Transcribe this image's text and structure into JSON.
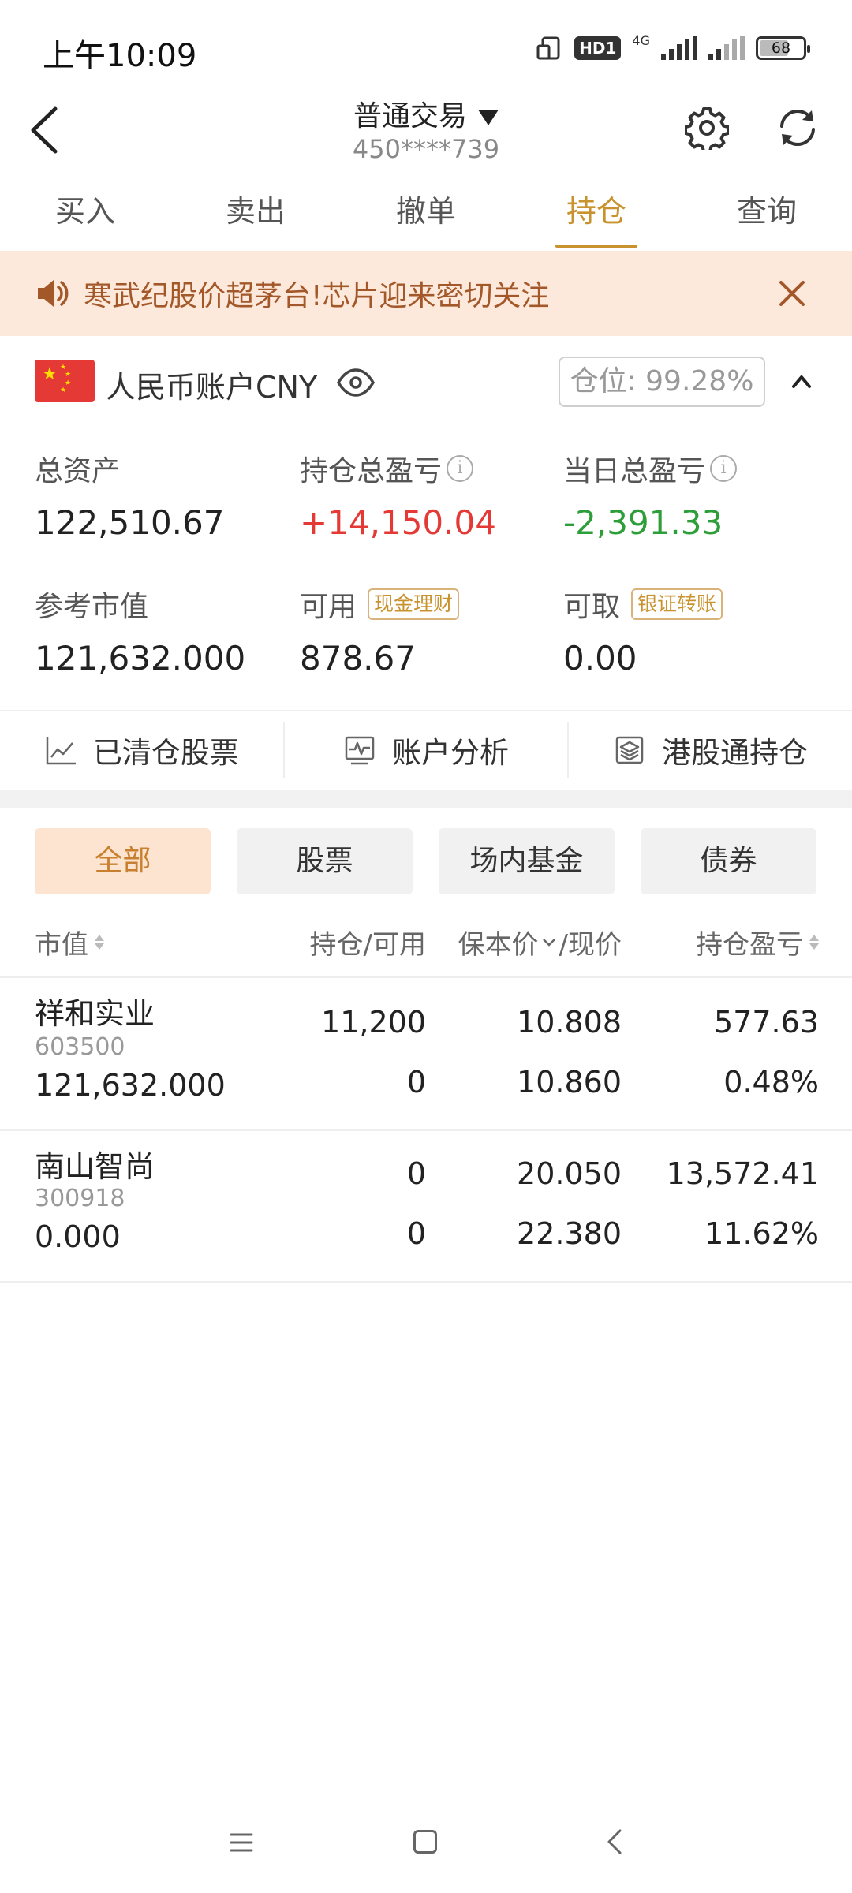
{
  "status": {
    "time": "上午10:09",
    "hd": "HD1",
    "net": "4G",
    "battery": "68"
  },
  "header": {
    "title": "普通交易",
    "account_masked": "450****739"
  },
  "tabs": [
    {
      "label": "买入",
      "active": false
    },
    {
      "label": "卖出",
      "active": false
    },
    {
      "label": "撤单",
      "active": false
    },
    {
      "label": "持仓",
      "active": true
    },
    {
      "label": "查询",
      "active": false
    }
  ],
  "notice": {
    "text": "寒武纪股价超茅台!芯片迎来密切关注"
  },
  "account": {
    "name": "人民币账户CNY",
    "position_ratio": "仓位: 99.28%",
    "total_assets_label": "总资产",
    "total_assets": "122,510.67",
    "holding_pl_label": "持仓总盈亏",
    "holding_pl": "+14,150.04",
    "daily_pl_label": "当日总盈亏",
    "daily_pl": "-2,391.33",
    "market_value_label": "参考市值",
    "market_value": "121,632.000",
    "available_label": "可用",
    "available_tag": "现金理财",
    "available": "878.67",
    "withdrawable_label": "可取",
    "withdrawable_tag": "银证转账",
    "withdrawable": "0.00"
  },
  "actions": [
    {
      "label": "已清仓股票",
      "icon": "chart-line-icon"
    },
    {
      "label": "账户分析",
      "icon": "analysis-icon"
    },
    {
      "label": "港股通持仓",
      "icon": "layers-icon"
    }
  ],
  "filters": [
    {
      "label": "全部",
      "active": true
    },
    {
      "label": "股票",
      "active": false
    },
    {
      "label": "场内基金",
      "active": false
    },
    {
      "label": "债券",
      "active": false
    }
  ],
  "table": {
    "headers": {
      "market_value": "市值",
      "position": "持仓/可用",
      "cost_price_a": "保本价",
      "cost_price_b": "/现价",
      "pl": "持仓盈亏"
    },
    "rows": [
      {
        "name": "祥和实业",
        "code": "603500",
        "market_value": "121,632.000",
        "position": "11,200",
        "available": "0",
        "cost": "10.808",
        "price": "10.860",
        "pl": "577.63",
        "pl_pct": "0.48%"
      },
      {
        "name": "南山智尚",
        "code": "300918",
        "market_value": "0.000",
        "position": "0",
        "available": "0",
        "cost": "20.050",
        "price": "22.380",
        "pl": "13,572.41",
        "pl_pct": "11.62%"
      }
    ]
  },
  "colors": {
    "accent": "#c8932f",
    "up": "#e53935",
    "down": "#2e9e3a",
    "notice_bg": "#fde9dc"
  }
}
